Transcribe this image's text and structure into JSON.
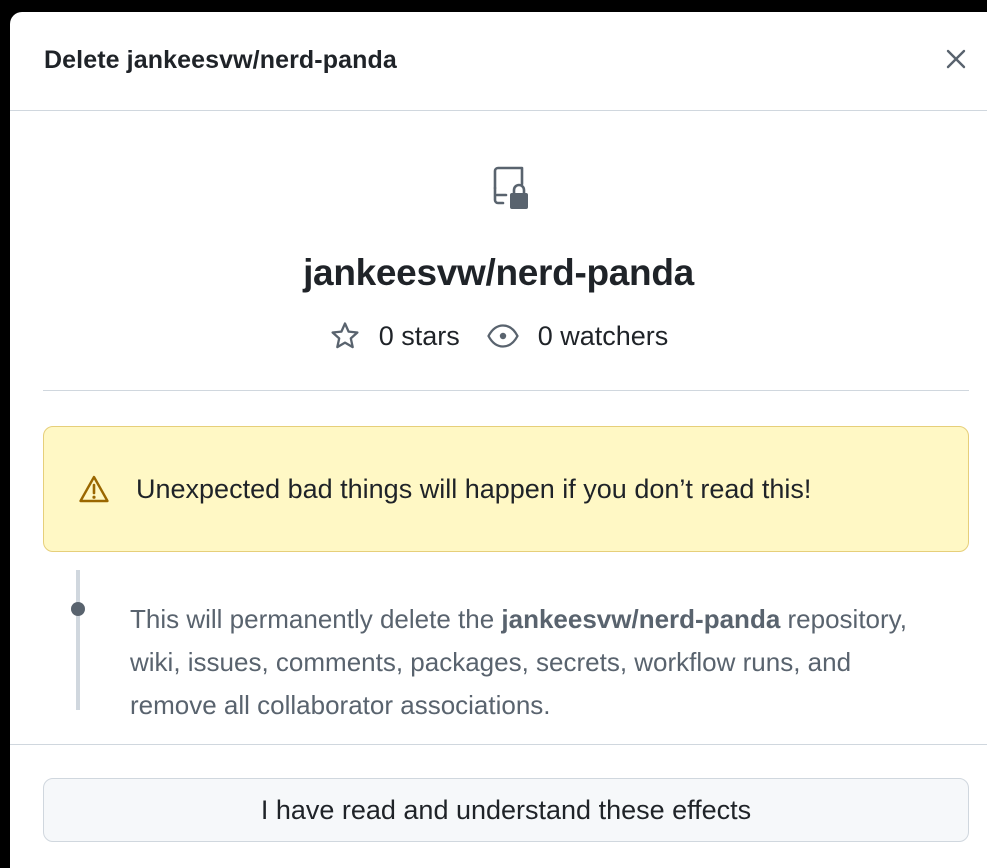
{
  "dialog": {
    "title": "Delete jankeesvw/nerd-panda",
    "close_icon": "x-icon"
  },
  "repo": {
    "icon": "repo-locked-icon",
    "name": "jankeesvw/nerd-panda",
    "stars_label": "0 stars",
    "watchers_label": "0 watchers"
  },
  "warning": {
    "icon": "alert-triangle-icon",
    "text": "Unexpected bad things will happen if you don’t read this!"
  },
  "effects": {
    "prefix": "This will permanently delete the ",
    "repo_name": "jankeesvw/nerd-panda",
    "suffix": " repository, wiki, issues, comments, packages, secrets, workflow runs, and remove all collaborator associations."
  },
  "footer": {
    "confirm_label": "I have read and understand these effects"
  },
  "colors": {
    "text_primary": "#1f2328",
    "text_muted": "#59636e",
    "border": "#d0d7de",
    "warning_bg": "#fff8c5",
    "warning_icon": "#9a6700"
  }
}
